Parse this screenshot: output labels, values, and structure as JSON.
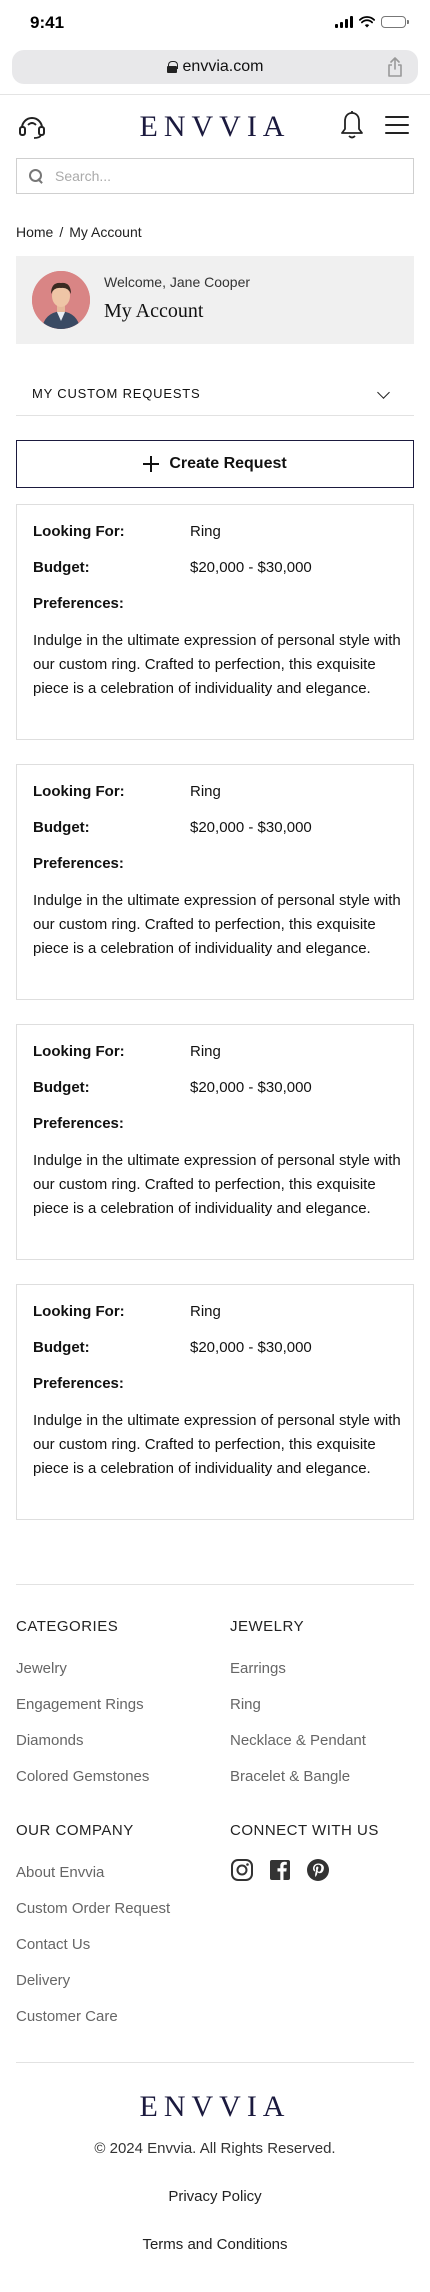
{
  "status_bar": {
    "time": "9:41"
  },
  "browser": {
    "url": "envvia.com"
  },
  "header": {
    "logo": "ENVVIA"
  },
  "search": {
    "placeholder": "Search..."
  },
  "breadcrumb": {
    "home": "Home",
    "separator": "/",
    "current": "My Account"
  },
  "account": {
    "welcome": "Welcome, Jane Cooper",
    "title": "My Account"
  },
  "requests_section": {
    "title": "MY CUSTOM REQUESTS",
    "create_label": "Create Request",
    "labels": {
      "looking_for": "Looking For:",
      "budget": "Budget:",
      "preferences": "Preferences:"
    },
    "items": [
      {
        "looking_for": "Ring",
        "budget": "$20,000 - $30,000",
        "preferences": "Indulge in the ultimate expression of personal style with our custom ring. Crafted to perfection, this exquisite piece is a celebration of individuality and elegance."
      },
      {
        "looking_for": "Ring",
        "budget": "$20,000 - $30,000",
        "preferences": "Indulge in the ultimate expression of personal style with our custom ring. Crafted to perfection, this exquisite piece is a celebration of individuality and elegance."
      },
      {
        "looking_for": "Ring",
        "budget": "$20,000 - $30,000",
        "preferences": "Indulge in the ultimate expression of personal style with our custom ring. Crafted to perfection, this exquisite piece is a celebration of individuality and elegance."
      },
      {
        "looking_for": "Ring",
        "budget": "$20,000 - $30,000",
        "preferences": "Indulge in the ultimate expression of personal style with our custom ring. Crafted to perfection, this exquisite piece is a celebration of individuality and elegance."
      }
    ]
  },
  "footer": {
    "categories": {
      "heading": "CATEGORIES",
      "links": [
        "Jewelry",
        "Engagement Rings",
        "Diamonds",
        "Colored Gemstones"
      ]
    },
    "jewelry": {
      "heading": "JEWELRY",
      "links": [
        "Earrings",
        "Ring",
        "Necklace & Pendant",
        "Bracelet & Bangle"
      ]
    },
    "company": {
      "heading": "OUR COMPANY",
      "links": [
        "About Envvia",
        "Custom Order Request",
        "Contact Us",
        "Delivery",
        "Customer Care"
      ]
    },
    "connect": {
      "heading": "CONNECT WITH US",
      "icons": [
        "instagram-icon",
        "facebook-icon",
        "pinterest-icon"
      ]
    },
    "logo": "ENVVIA",
    "copyright": "© 2024 Envvia. All Rights Reserved.",
    "privacy": "Privacy Policy",
    "terms": "Terms and Conditions"
  },
  "colors": {
    "brand_navy": "#1b1a3e",
    "banner_bg": "#f0f0f0",
    "muted_text": "#666666"
  }
}
